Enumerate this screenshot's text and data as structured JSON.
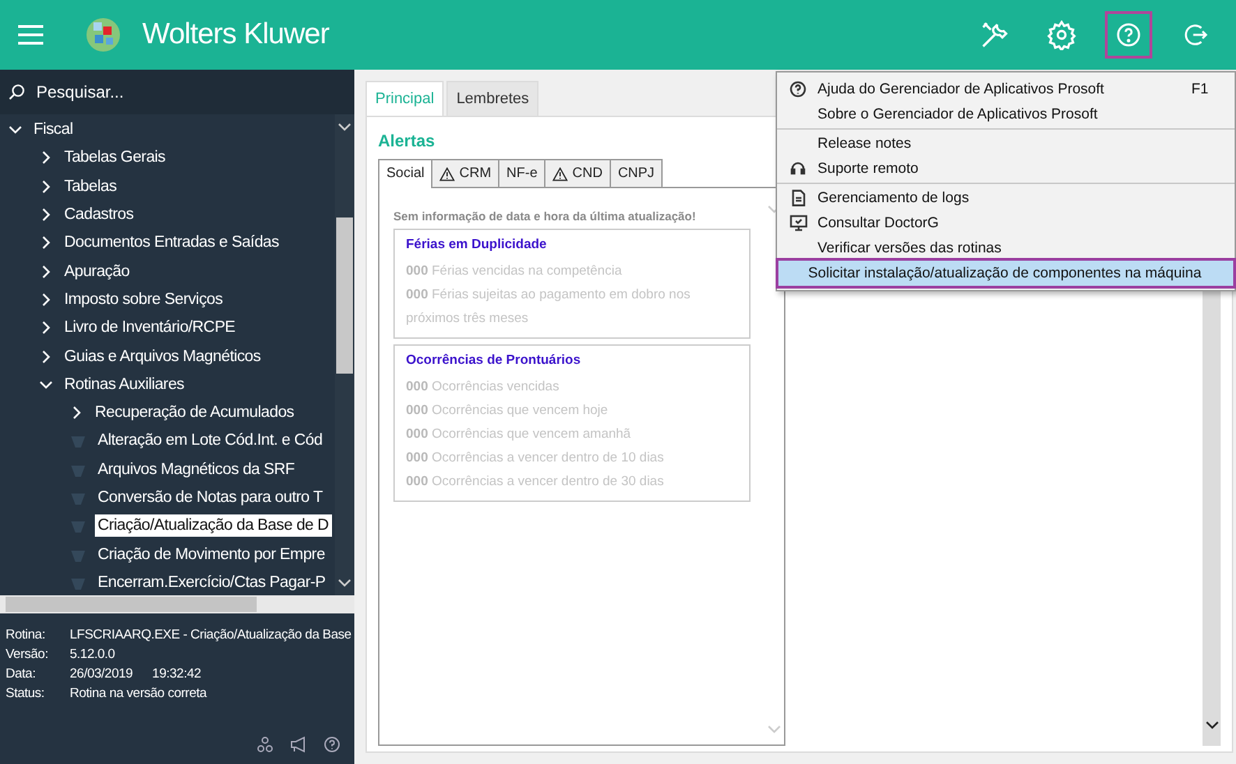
{
  "header": {
    "brand": "Wolters Kluwer",
    "actions": [
      {
        "kind": "tools",
        "active": false
      },
      {
        "kind": "settings",
        "active": false
      },
      {
        "kind": "help",
        "active": true
      },
      {
        "kind": "exit",
        "active": false
      }
    ]
  },
  "sidebar": {
    "search": {
      "placeholder": "Pesquisar..."
    },
    "tree": [
      {
        "label": "Fiscal",
        "kind": "branch",
        "expanded": true,
        "selected": false,
        "children": [
          {
            "label": "Tabelas Gerais",
            "kind": "branch",
            "expanded": false,
            "selected": false
          },
          {
            "label": "Tabelas",
            "kind": "branch",
            "expanded": false,
            "selected": false
          },
          {
            "label": "Cadastros",
            "kind": "branch",
            "expanded": false,
            "selected": false
          },
          {
            "label": "Documentos Entradas e Saídas",
            "kind": "branch",
            "expanded": false,
            "selected": false
          },
          {
            "label": "Apuração",
            "kind": "branch",
            "expanded": false,
            "selected": false
          },
          {
            "label": "Imposto sobre Serviços",
            "kind": "branch",
            "expanded": false,
            "selected": false
          },
          {
            "label": "Livro de Inventário/RCPE",
            "kind": "branch",
            "expanded": false,
            "selected": false
          },
          {
            "label": "Guias e Arquivos Magnéticos",
            "kind": "branch",
            "expanded": false,
            "selected": false
          },
          {
            "label": "Rotinas Auxiliares",
            "kind": "branch",
            "expanded": true,
            "selected": false,
            "children": [
              {
                "label": "Recuperação de Acumulados",
                "kind": "branch",
                "expanded": false,
                "selected": false
              },
              {
                "label": "Alteração em Lote Cód.Int. e Cód",
                "kind": "leaf",
                "selected": false
              },
              {
                "label": "Arquivos Magnéticos da SRF",
                "kind": "leaf",
                "selected": false
              },
              {
                "label": "Conversão de Notas para outro T",
                "kind": "leaf",
                "selected": false
              },
              {
                "label": "Criação/Atualização da Base de D",
                "kind": "leaf",
                "selected": true
              },
              {
                "label": "Criação de Movimento por Empre",
                "kind": "leaf",
                "selected": false
              },
              {
                "label": "Encerram.Exercício/Ctas Pagar-P",
                "kind": "leaf",
                "selected": false
              }
            ]
          }
        ]
      }
    ],
    "info": [
      {
        "label": "Rotina:",
        "value": "LFSCRIAARQ.EXE - Criação/Atualização da Base"
      },
      {
        "label": "Versão:",
        "value": "5.12.0.0"
      },
      {
        "label": "Data:",
        "value": "26/03/2019",
        "time": "19:32:42"
      },
      {
        "label": "Status:",
        "value": "Rotina na versão correta"
      }
    ]
  },
  "main": {
    "tabs": [
      {
        "label": "Principal",
        "selected": true
      },
      {
        "label": "Lembretes",
        "selected": false
      }
    ],
    "section_title": "Alertas",
    "alert_tabs": [
      {
        "label": "Social",
        "warning": false,
        "selected": true
      },
      {
        "label": "CRM",
        "warning": true,
        "selected": false
      },
      {
        "label": "NF-e",
        "warning": false,
        "selected": false
      },
      {
        "label": "CND",
        "warning": true,
        "selected": false
      },
      {
        "label": "CNPJ",
        "warning": false,
        "selected": false
      }
    ],
    "notice": "Sem informação de data e hora da última atualização!",
    "groups": [
      {
        "title": "Férias em Duplicidade",
        "lines": [
          "**000** Férias vencidas na competência",
          "**000** Férias sujeitas ao pagamento em dobro nos próximos três meses"
        ]
      },
      {
        "title": "Ocorrências de Prontuários",
        "lines": [
          "**000** Ocorrências vencidas",
          "**000** Ocorrências que vencem hoje",
          "**000** Ocorrências que vencem amanhã",
          "**000** Ocorrências a vencer dentro de 10 dias",
          "**000** Ocorrências a vencer dentro de 30 dias"
        ]
      }
    ]
  },
  "menu": {
    "groups": [
      [
        {
          "label": "Ajuda do Gerenciador de Aplicativos Prosoft",
          "kind": "help",
          "shortcut": "F1",
          "selected": false
        },
        {
          "label": "Sobre o Gerenciador de Aplicativos Prosoft",
          "kind": "plain",
          "selected": false
        }
      ],
      [
        {
          "label": "Release notes",
          "kind": "plain",
          "selected": false
        },
        {
          "label": "Suporte remoto",
          "kind": "headset",
          "selected": false
        }
      ],
      [
        {
          "label": "Gerenciamento de logs",
          "kind": "document",
          "selected": false
        },
        {
          "label": "Consultar DoctorG",
          "kind": "monitor",
          "selected": false
        },
        {
          "label": "Verificar versões das rotinas",
          "kind": "plain",
          "selected": false
        },
        {
          "label": "Solicitar instalação/atualização de componentes na máquina",
          "kind": "plain",
          "selected": true
        }
      ]
    ]
  }
}
